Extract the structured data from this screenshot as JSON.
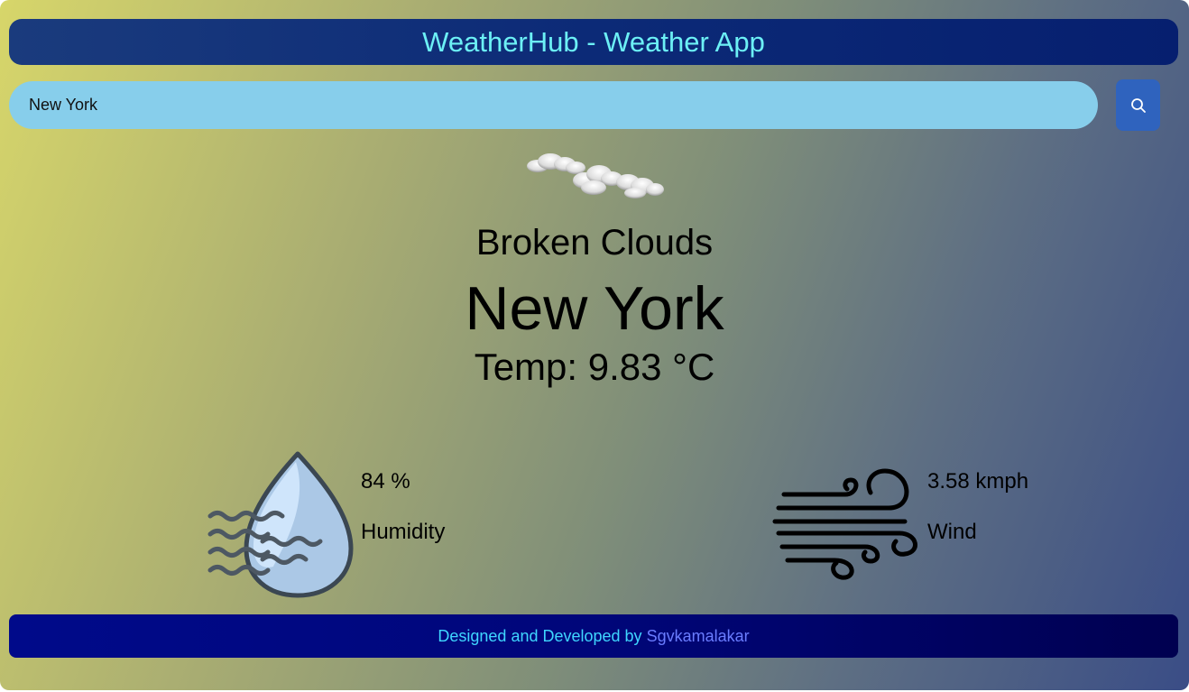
{
  "header": {
    "title": "WeatherHub - Weather App"
  },
  "search": {
    "value": "New York",
    "button_icon": "search-icon"
  },
  "weather": {
    "icon": "broken-clouds-icon",
    "description": "Broken Clouds",
    "city": "New York",
    "temp": "Temp: 9.83 °C"
  },
  "humidity": {
    "icon": "humidity-icon",
    "value": "84 %",
    "label": "Humidity"
  },
  "wind": {
    "icon": "wind-icon",
    "value": "3.58 kmph",
    "label": "Wind"
  },
  "footer": {
    "text": "Designed and Developed by",
    "author": "Sgvkamalakar"
  },
  "colors": {
    "header_bg": "#0c2a77",
    "header_text": "#6cf0f5",
    "search_bg": "#87ceeb",
    "search_button": "#2f63be",
    "footer_bg": "#00067a",
    "footer_text": "#3fd6ff",
    "footer_link": "#6a7cff"
  }
}
